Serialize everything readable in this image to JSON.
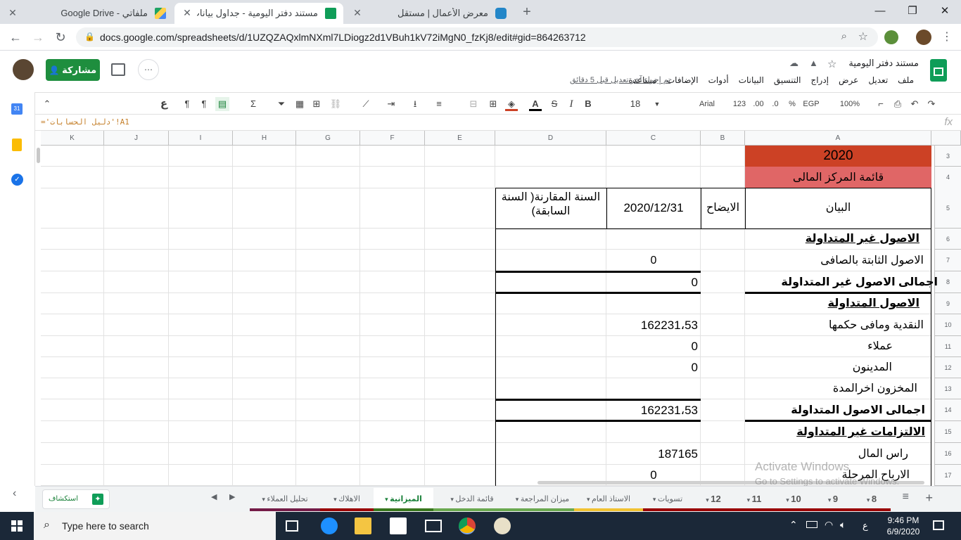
{
  "browser": {
    "tabs": [
      {
        "title": "ملفاتي - Google Drive",
        "active": false
      },
      {
        "title": "مستند دفتر اليومية - جداول بيانات Google",
        "active": true
      },
      {
        "title": "معرض الأعمال | مستقل",
        "active": false
      }
    ],
    "new_tab": "+",
    "url": "docs.google.com/spreadsheets/d/1UZQZAQxlmNXml7LDiogz2d1VBuh1kV72iMgN0_fzKj8/edit#gid=864263712"
  },
  "sheets": {
    "doc_title": "مستند دفتر اليومية",
    "menu": [
      "ملف",
      "تعديل",
      "عرض",
      "إدراج",
      "التنسيق",
      "البيانات",
      "أدوات",
      "الإضافات",
      "مساعدة"
    ],
    "last_edit": "تم إجراء آخر تعديل قبل 5 دقائق",
    "share_label": "مشاركة",
    "toolbar": {
      "zoom": "100%",
      "currency": "EGP",
      "percent": "%",
      "decimal_less": ".0",
      "decimal_more": ".00",
      "format_123": "123",
      "font": "Arial",
      "font_size": "18",
      "bold": "B",
      "italic": "I",
      "strike": "S",
      "text_color": "A",
      "sigma": "Σ",
      "rtl_glyph": "ع"
    },
    "formula": "='دليل الحسابات'!A1",
    "fx": "fx"
  },
  "grid": {
    "columns": [
      "K",
      "J",
      "I",
      "H",
      "G",
      "F",
      "E",
      "D",
      "C",
      "B",
      "A"
    ],
    "rows": [
      "3",
      "4",
      "5",
      "6",
      "7",
      "8",
      "9",
      "10",
      "11",
      "12",
      "13",
      "14",
      "15",
      "16",
      "17"
    ],
    "cells": {
      "A3": "2020",
      "A4": "قائمة المركز المالى",
      "A5": "البيان",
      "B5": "الايضاح",
      "C5": "2020/12/31",
      "D5": "السنة المقارنة( السنة السابقة)",
      "A6": "الاصول غير المتداولة",
      "A7": "الاصول الثابتة بالصافى",
      "C7": "0",
      "A8": "اجمالى الاصول غير المتداولة",
      "C8": "0",
      "A9": "الاصول المتداولة",
      "A10": "النقدية ومافى حكمها",
      "C10": "162231،53",
      "A11": "عملاء",
      "C11": "0",
      "A12": "المدينون",
      "C12": "0",
      "A13": "المخزون اخرالمدة",
      "A14": "اجمالى الاصول المتداولة",
      "C14": "162231،53",
      "A15": "الالتزامات غير المتداولة",
      "A16": "راس المال",
      "C16": "187165",
      "A17": "الارباح المرحلة",
      "C17": "0"
    },
    "colors": {
      "header_year": "#cc4125",
      "header_title": "#e06666"
    }
  },
  "sheet_tabs": [
    {
      "label": "8",
      "color": "#990000"
    },
    {
      "label": "9",
      "color": "#990000"
    },
    {
      "label": "10",
      "color": "#990000"
    },
    {
      "label": "11",
      "color": "#990000"
    },
    {
      "label": "12",
      "color": "#990000"
    },
    {
      "label": "تسويات",
      "color": "#990000"
    },
    {
      "label": "الاستاذ العام",
      "color": "#f1c232"
    },
    {
      "label": "ميزان المراجعة",
      "color": "#6aa84f"
    },
    {
      "label": "قائمة الدخل",
      "color": "#6aa84f"
    },
    {
      "label": "الميزانية",
      "color": "#38761d",
      "active": true
    },
    {
      "label": "الاهلاك",
      "color": "#990000"
    },
    {
      "label": "تحليل العملاء",
      "color": "#741b47"
    }
  ],
  "explore_label": "استكشاف",
  "watermark": {
    "line1": "Activate Windows",
    "line2": "Go to Settings to activate Windows."
  },
  "taskbar": {
    "search_placeholder": "Type here to search",
    "time": "9:46 PM",
    "date": "6/9/2020",
    "lang": "ع"
  }
}
